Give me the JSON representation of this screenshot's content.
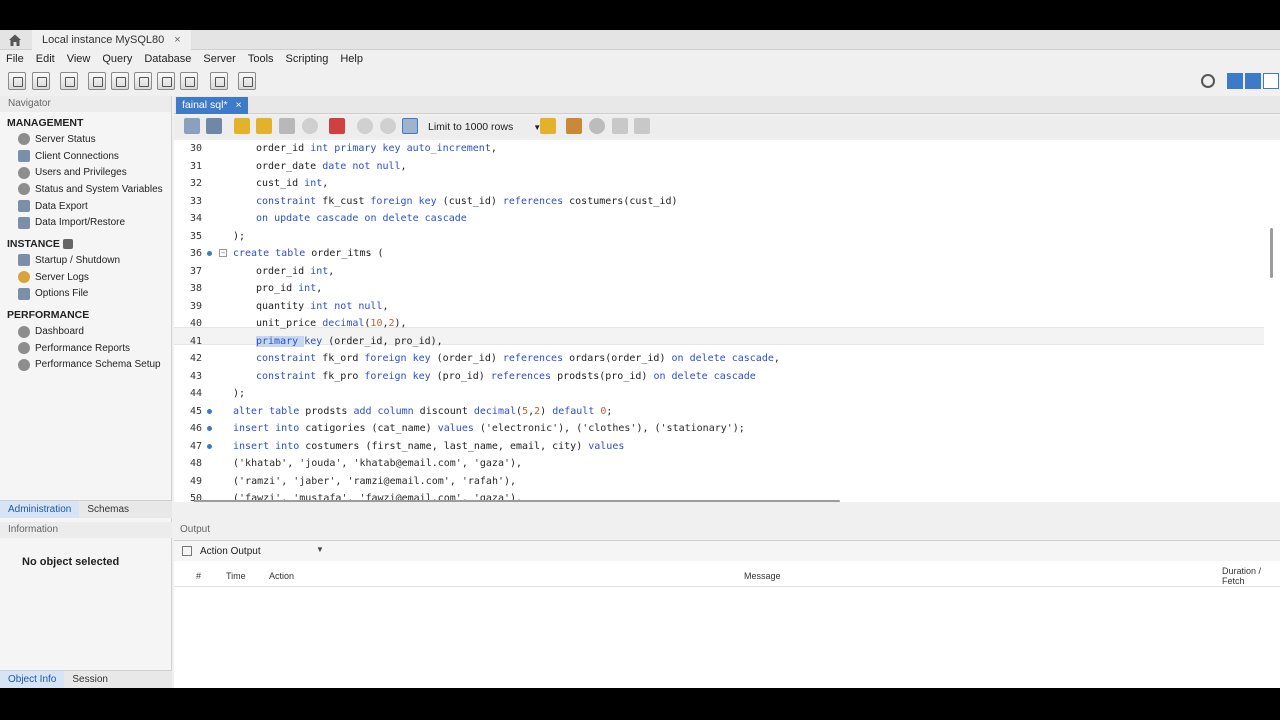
{
  "window": {
    "tab_title": "Local instance MySQL80",
    "close_symbol": "×"
  },
  "menu": [
    "File",
    "Edit",
    "View",
    "Query",
    "Database",
    "Server",
    "Tools",
    "Scripting",
    "Help"
  ],
  "navigator": {
    "header": "Navigator",
    "management_title": "MANAGEMENT",
    "management_items": [
      "Server Status",
      "Client Connections",
      "Users and Privileges",
      "Status and System Variables",
      "Data Export",
      "Data Import/Restore"
    ],
    "instance_title": "INSTANCE",
    "instance_items": [
      "Startup / Shutdown",
      "Server Logs",
      "Options File"
    ],
    "performance_title": "PERFORMANCE",
    "performance_items": [
      "Dashboard",
      "Performance Reports",
      "Performance Schema Setup"
    ],
    "tabs": [
      "Administration",
      "Schemas"
    ],
    "info_header": "Information",
    "no_object": "No object selected",
    "bottom_tabs": [
      "Object Info",
      "Session"
    ]
  },
  "editor": {
    "file_tab": "fainal sql*",
    "limit_label": "Limit to 1000 rows",
    "lines": [
      {
        "n": "30",
        "code": "order_id int primary key auto_increment,",
        "indent": 2
      },
      {
        "n": "31",
        "code": "order_date date not null,",
        "indent": 2
      },
      {
        "n": "32",
        "code": "cust_id int,",
        "indent": 2
      },
      {
        "n": "33",
        "code": "constraint fk_cust foreign key (cust_id) references costumers(cust_id)",
        "indent": 2
      },
      {
        "n": "34",
        "code": "on update cascade on delete cascade",
        "indent": 2
      },
      {
        "n": "35",
        "code": ");",
        "indent": 0
      },
      {
        "n": "36",
        "code": "create table order_itms (",
        "indent": 0
      },
      {
        "n": "37",
        "code": "order_id int,",
        "indent": 2
      },
      {
        "n": "38",
        "code": "pro_id int,",
        "indent": 2
      },
      {
        "n": "39",
        "code": "quantity int not null,",
        "indent": 2
      },
      {
        "n": "40",
        "code": "unit_price decimal(10,2),",
        "indent": 2
      },
      {
        "n": "41",
        "code": "primary key (order_id, pro_id),",
        "indent": 2
      },
      {
        "n": "42",
        "code": "constraint fk_ord foreign key (order_id) references ordars(order_id) on delete cascade,",
        "indent": 2
      },
      {
        "n": "43",
        "code": "constraint fk_pro foreign key (pro_id) references prodsts(pro_id) on delete cascade",
        "indent": 2
      },
      {
        "n": "44",
        "code": ");",
        "indent": 0
      },
      {
        "n": "45",
        "code": "alter table prodsts add column discount decimal(5,2) default 0;",
        "indent": 0
      },
      {
        "n": "46",
        "code": "insert into catigories (cat_name) values ('electronic'), ('clothes'), ('stationary');",
        "indent": 0
      },
      {
        "n": "47",
        "code": "insert into costumers (first_name, last_name, email, city) values",
        "indent": 0
      },
      {
        "n": "48",
        "code": "('khatab', 'jouda', 'khatab@email.com', 'gaza'),",
        "indent": 0
      },
      {
        "n": "49",
        "code": "('ramzi', 'jaber', 'ramzi@email.com', 'rafah'),",
        "indent": 0
      },
      {
        "n": "50",
        "code": "('fawzi', 'mustafa', 'fawzi@email.com', 'gaza'),",
        "indent": 0
      }
    ]
  },
  "output": {
    "header": "Output",
    "mode": "Action Output",
    "columns": [
      "#",
      "Time",
      "Action",
      "Message",
      "Duration / Fetch"
    ]
  },
  "colors": {
    "accent": "#3d7ac8",
    "keyword": "#2c4fc9"
  }
}
